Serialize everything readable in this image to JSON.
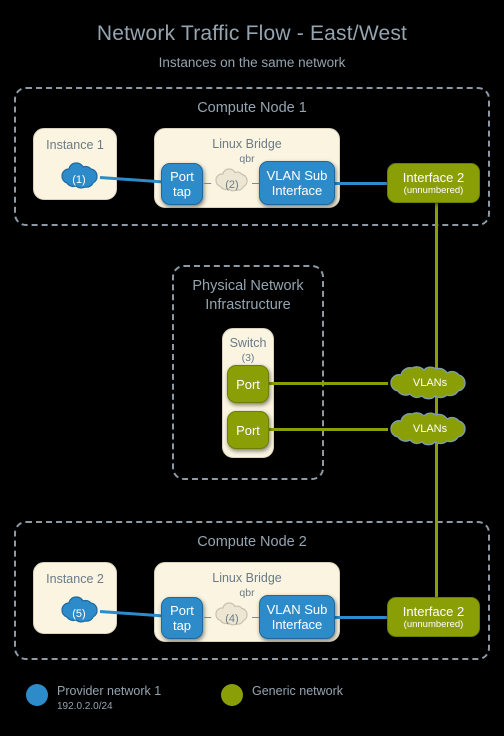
{
  "title": "Network Traffic Flow - East/West",
  "subtitle": "Instances on the same network",
  "colors": {
    "provider_network_blue": "#2e8bca",
    "generic_network_olive": "#8a9e06",
    "panel_cream": "#faf4e0",
    "text_muted": "#94a4b0",
    "dashed_border": "#8d9aa5"
  },
  "compute_node_1": {
    "title": "Compute Node 1",
    "instance": {
      "title": "Instance 1",
      "cloud_label": "(1)"
    },
    "bridge": {
      "title": "Linux Bridge",
      "subtitle": "qbr",
      "port": {
        "line1": "Port",
        "line2": "tap"
      },
      "cloud_label": "(2)",
      "vlan_sub": {
        "line1": "VLAN Sub",
        "line2": "Interface"
      }
    },
    "interface": {
      "line1": "Interface 2",
      "line2": "(unnumbered)"
    }
  },
  "physical_network": {
    "title_line1": "Physical Network",
    "title_line2": "Infrastructure",
    "switch": {
      "title": "Switch",
      "subtitle": "(3)",
      "port_top": "Port",
      "port_bottom": "Port"
    },
    "vlans_top": "VLANs",
    "vlans_bottom": "VLANs"
  },
  "compute_node_2": {
    "title": "Compute Node 2",
    "instance": {
      "title": "Instance 2",
      "cloud_label": "(5)"
    },
    "bridge": {
      "title": "Linux Bridge",
      "subtitle": "qbr",
      "port": {
        "line1": "Port",
        "line2": "tap"
      },
      "cloud_label": "(4)",
      "vlan_sub": {
        "line1": "VLAN Sub",
        "line2": "Interface"
      }
    },
    "interface": {
      "line1": "Interface 2",
      "line2": "(unnumbered)"
    }
  },
  "legend": {
    "provider": {
      "label": "Provider network 1",
      "subnet": "192.0.2.0/24"
    },
    "generic": {
      "label": "Generic network"
    }
  }
}
